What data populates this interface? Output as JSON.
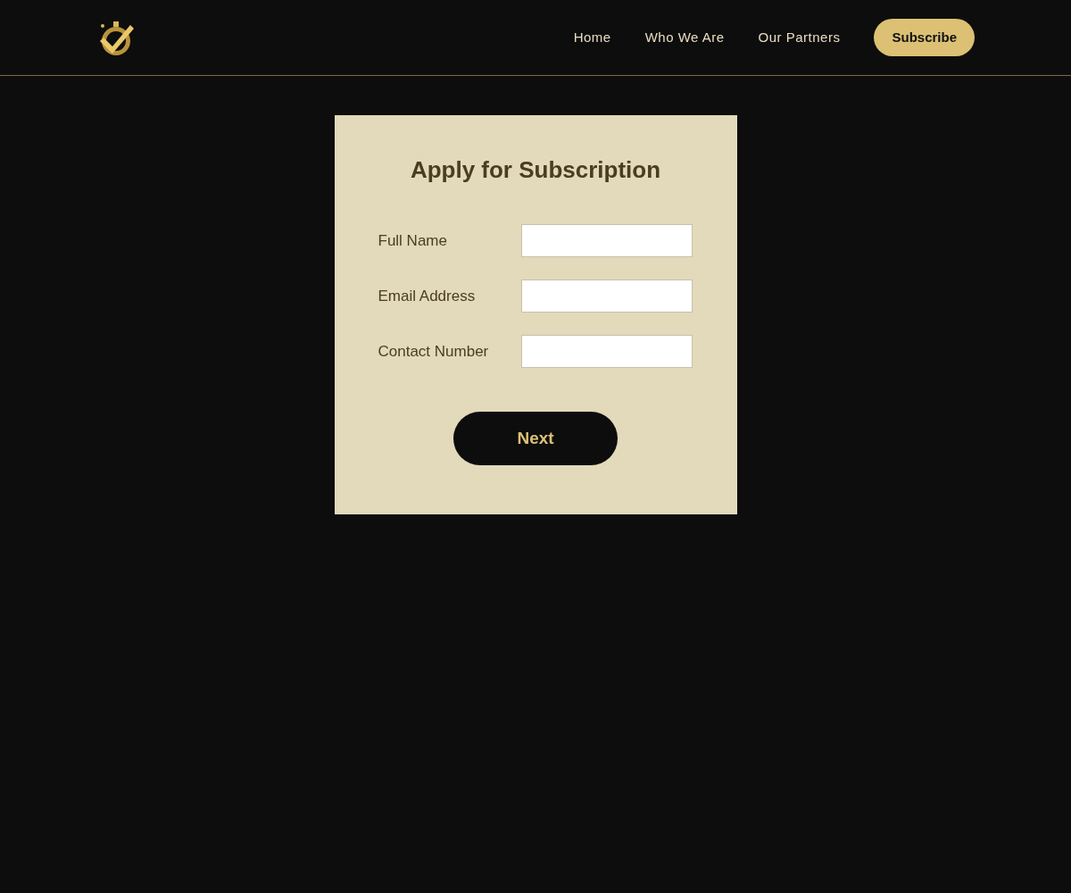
{
  "nav": {
    "links": [
      "Home",
      "Who We Are",
      "Our Partners"
    ],
    "cta": "Subscribe"
  },
  "form": {
    "title": "Apply for Subscription",
    "fields": [
      {
        "label": "Full Name"
      },
      {
        "label": "Email Address"
      },
      {
        "label": "Contact Number"
      }
    ],
    "submit": "Next"
  }
}
